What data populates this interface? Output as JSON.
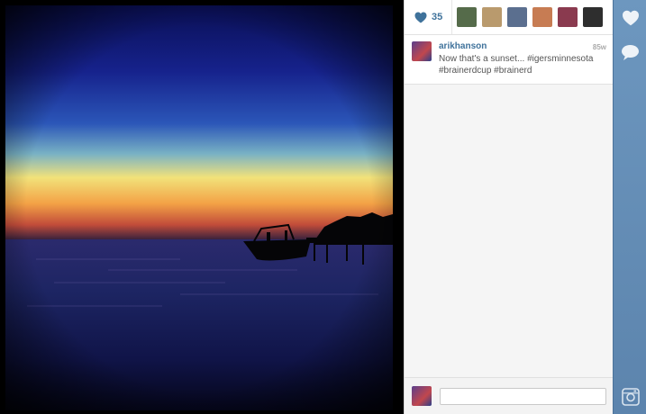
{
  "post": {
    "like_count": "35",
    "username": "arikhanson",
    "time_ago": "85w",
    "caption": "Now that's a sunset... #igersminnesota #brainerdcup #brainerd"
  },
  "likers": [
    {
      "name": "liker-1",
      "color": "#556b4a"
    },
    {
      "name": "liker-2",
      "color": "#b99a6d"
    },
    {
      "name": "liker-3",
      "color": "#5b6f8f"
    },
    {
      "name": "liker-4",
      "color": "#c77c53"
    },
    {
      "name": "liker-5",
      "color": "#8a3a4f"
    },
    {
      "name": "liker-6",
      "color": "#2e2e2e"
    }
  ],
  "icons": {
    "like": "heart-icon",
    "comment": "speech-bubble-icon",
    "brand": "instagram-camera-icon"
  },
  "colors": {
    "accent": "#3f729b",
    "rail": "#5c84ad"
  },
  "comment_input": {
    "value": "",
    "placeholder": ""
  }
}
